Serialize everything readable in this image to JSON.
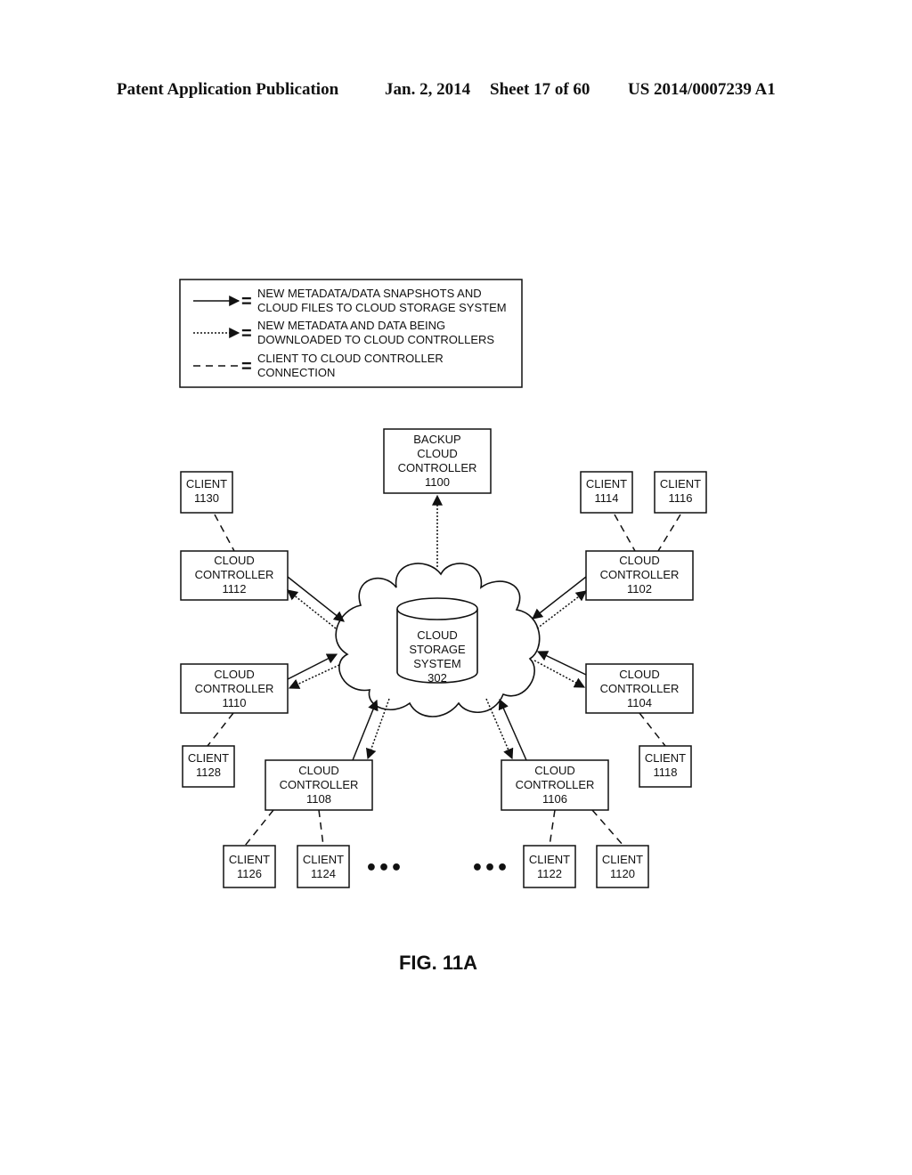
{
  "header": {
    "publication": "Patent Application Publication",
    "date": "Jan. 2, 2014",
    "sheet": "Sheet 17 of 60",
    "number": "US 2014/0007239 A1"
  },
  "legend": {
    "items": [
      {
        "line": "solid-arrow",
        "lines": [
          "NEW METADATA/DATA SNAPSHOTS AND",
          "CLOUD FILES TO CLOUD STORAGE SYSTEM"
        ]
      },
      {
        "line": "dotted-arrow",
        "lines": [
          "NEW METADATA AND DATA BEING",
          "DOWNLOADED TO CLOUD CONTROLLERS"
        ]
      },
      {
        "line": "dashed",
        "lines": [
          "CLIENT TO CLOUD CONTROLLER",
          "CONNECTION"
        ]
      }
    ],
    "equals": "="
  },
  "storage": {
    "lines": [
      "CLOUD",
      "STORAGE",
      "SYSTEM",
      "302"
    ]
  },
  "backup": {
    "lines": [
      "BACKUP",
      "CLOUD",
      "CONTROLLER",
      "1100"
    ]
  },
  "controllers": [
    {
      "id": "1112",
      "lines": [
        "CLOUD",
        "CONTROLLER",
        "1112"
      ]
    },
    {
      "id": "1110",
      "lines": [
        "CLOUD",
        "CONTROLLER",
        "1110"
      ]
    },
    {
      "id": "1108",
      "lines": [
        "CLOUD",
        "CONTROLLER",
        "1108"
      ]
    },
    {
      "id": "1106",
      "lines": [
        "CLOUD",
        "CONTROLLER",
        "1106"
      ]
    },
    {
      "id": "1104",
      "lines": [
        "CLOUD",
        "CONTROLLER",
        "1104"
      ]
    },
    {
      "id": "1102",
      "lines": [
        "CLOUD",
        "CONTROLLER",
        "1102"
      ]
    }
  ],
  "clients": [
    {
      "id": "1130",
      "lines": [
        "CLIENT",
        "1130"
      ]
    },
    {
      "id": "1128",
      "lines": [
        "CLIENT",
        "1128"
      ]
    },
    {
      "id": "1126",
      "lines": [
        "CLIENT",
        "1126"
      ]
    },
    {
      "id": "1124",
      "lines": [
        "CLIENT",
        "1124"
      ]
    },
    {
      "id": "1122",
      "lines": [
        "CLIENT",
        "1122"
      ]
    },
    {
      "id": "1120",
      "lines": [
        "CLIENT",
        "1120"
      ]
    },
    {
      "id": "1118",
      "lines": [
        "CLIENT",
        "1118"
      ]
    },
    {
      "id": "1114",
      "lines": [
        "CLIENT",
        "1114"
      ]
    },
    {
      "id": "1116",
      "lines": [
        "CLIENT",
        "1116"
      ]
    }
  ],
  "ellipsis": "•••",
  "figure_label": "FIG. 11A"
}
